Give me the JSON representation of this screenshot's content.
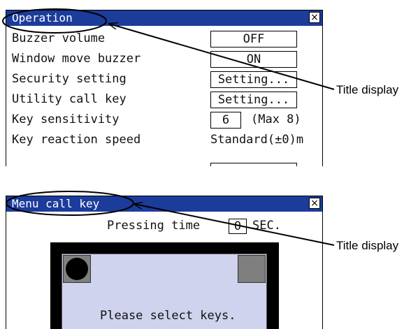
{
  "top_panel": {
    "title": "Operation",
    "close_glyph": "×",
    "rows": [
      {
        "label": "Buzzer volume",
        "control": "OFF"
      },
      {
        "label": "Window move buzzer",
        "control": "ON"
      },
      {
        "label": "Security setting",
        "control": "Setting..."
      },
      {
        "label": "Utility call key",
        "control": "Setting..."
      },
      {
        "label": "Key sensitivity",
        "control": "6",
        "extra": "(Max 8)"
      },
      {
        "label": "Key reaction speed",
        "control": "Standard(±0)m"
      }
    ]
  },
  "bottom_panel": {
    "title": "Menu call key",
    "close_glyph": "×",
    "pressing_label": "Pressing time",
    "pressing_value": "0",
    "pressing_unit": "SEC.",
    "select_message": "Please select keys."
  },
  "callouts": {
    "top": "Title display",
    "bottom": "Title display"
  },
  "colors": {
    "titlebar": "#1c3c9c",
    "screen_bg": "#cfd3ee",
    "frame": "#000000"
  }
}
